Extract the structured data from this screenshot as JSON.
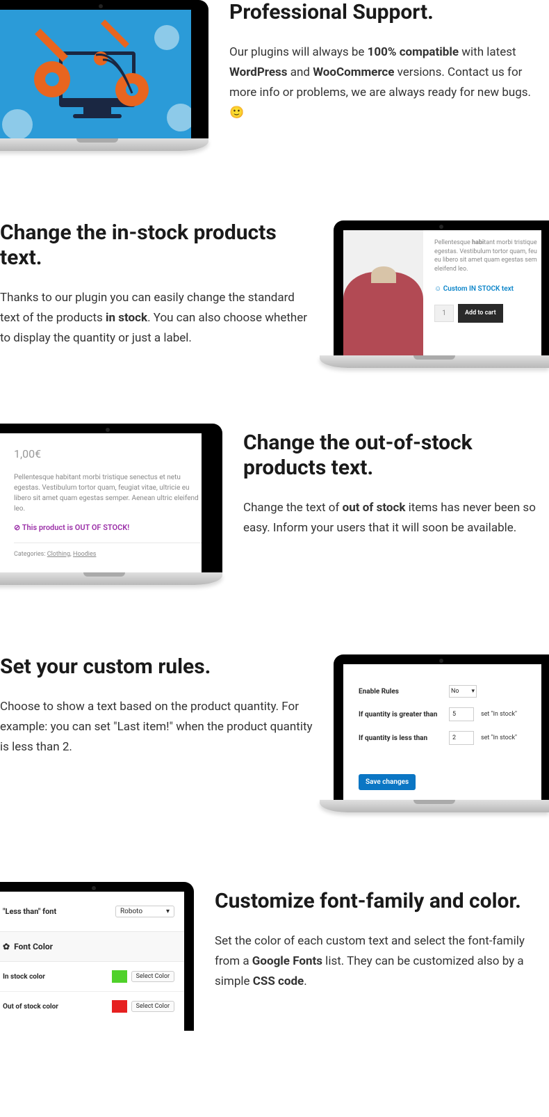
{
  "s1": {
    "title": "Professional Support.",
    "p_a": "Our plugins will always be ",
    "p_b": "100% compatible",
    "p_c": " with latest ",
    "p_d": "WordPress",
    "p_e": " and ",
    "p_f": "WooCommerce",
    "p_g": " versions. Contact us for more info or problems, we are always ready for new bugs. 🙂"
  },
  "s2": {
    "title": "Change the in-stock products text.",
    "p_a": "Thanks to our plugin you can easily change the standard text of the products ",
    "p_b": "in stock",
    "p_c": ". You can also choose whether to display the quantity or just a label.",
    "lorem": "Pellentesque habitant morbi tristique egestas. Vestibulum tortor quam, feu eu libero sit amet quam egestas sem eleifend leo.",
    "lorem_bold": "habi",
    "stock": "Custom IN STOCK text",
    "qty": "1",
    "btn": "Add to cart"
  },
  "s3": {
    "title": "Change the out-of-stock products text.",
    "p_a": "Change the text of ",
    "p_b": "out of stock",
    "p_c": " items has never been so easy. Inform your users that it will soon be available.",
    "price": "1,00€",
    "lorem": "Pellentesque habitant morbi tristique senectus et netu egestas. Vestibulum tortor quam, feugiat vitae, ultricie eu libero sit amet quam egestas semper. Aenean ultric eleifend leo.",
    "oos": "This product is OUT OF STOCK!",
    "cat_label": "Categories:",
    "cat1": "Clothing",
    "cat2": "Hoodies"
  },
  "s4": {
    "title": "Set your custom rules.",
    "p": "Choose to show a text based on the product quantity. For example: you can set \"Last item!\" when the product quantity is less than 2.",
    "row1": "Enable Rules",
    "row1_val": "No",
    "row2": "If quantity is greater than",
    "row2_val": "5",
    "row2_tail": "set \"In stock\"",
    "row3": "If quantity is less than",
    "row3_val": "2",
    "row3_tail": "set \"In stock\"",
    "save": "Save changes"
  },
  "s5": {
    "title": "Customize font-family and color.",
    "p_a": "Set the color of each custom text and select the font-family from a ",
    "p_b": "Google Fonts",
    "p_c": " list. They can be customized also by a simple ",
    "p_d": "CSS code",
    "p_e": ".",
    "less_a": "\"Less than\" ",
    "less_b": "font",
    "less_val": "Roboto",
    "section": "Font Color",
    "row1": "In stock color",
    "row2": "Out of stock color",
    "select": "Select Color"
  }
}
